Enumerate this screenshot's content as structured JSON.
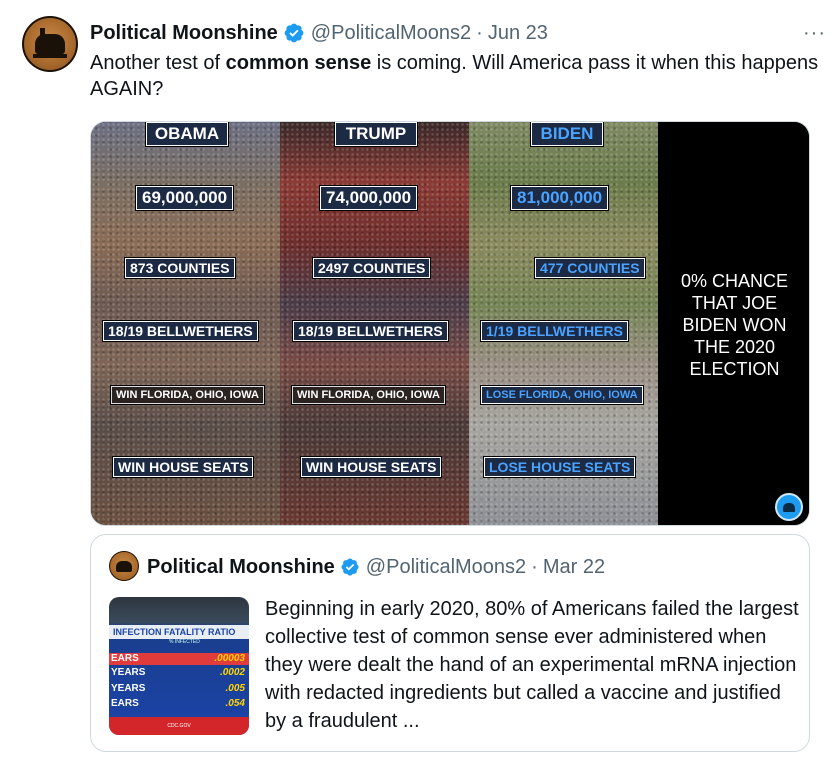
{
  "tweet": {
    "author_name": "Political Moonshine",
    "handle": "@PoliticalMoons2",
    "separator": "·",
    "date": "Jun 23",
    "more": "···",
    "text_before": "Another test of ",
    "text_bold": "common sense",
    "text_after": " is coming. Will America pass it when this happens AGAIN?"
  },
  "media": {
    "columns": [
      {
        "header": "OBAMA",
        "votes": "69,000,000",
        "counties": "873 COUNTIES",
        "bellwethers": "18/19 BELLWETHERS",
        "states": "WIN FLORIDA, OHIO, IOWA",
        "house": "WIN HOUSE SEATS"
      },
      {
        "header": "TRUMP",
        "votes": "74,000,000",
        "counties": "2497 COUNTIES",
        "bellwethers": "18/19 BELLWETHERS",
        "states": "WIN FLORIDA, OHIO, IOWA",
        "house": "WIN HOUSE SEATS"
      },
      {
        "header": "BIDEN",
        "votes": "81,000,000",
        "counties": "477 COUNTIES",
        "bellwethers": "1/19 BELLWETHERS",
        "states": "LOSE FLORIDA, OHIO, IOWA",
        "house": "LOSE HOUSE SEATS"
      }
    ],
    "side_text": "0% CHANCE THAT JOE BIDEN WON THE 2020 ELECTION"
  },
  "quote": {
    "author_name": "Political Moonshine",
    "handle": "@PoliticalMoons2",
    "separator": "·",
    "date": "Mar 22",
    "text": "Beginning in early 2020, 80% of Americans failed the largest collective test of common sense ever administered when they were dealt the hand of an experimental mRNA injection with redacted ingredients but called a vaccine and justified by a fraudulent ...",
    "thumb": {
      "title": "INFECTION FATALITY RATIO",
      "subtitle": "% INFECTED",
      "rows": [
        {
          "left": "EARS",
          "right": ".00003"
        },
        {
          "left": "YEARS",
          "right": ".0002"
        },
        {
          "left": "YEARS",
          "right": ".005"
        },
        {
          "left": "EARS",
          "right": ".054"
        }
      ],
      "footer": "CDC.GOV"
    }
  },
  "colors": {
    "verified": "#1d9bf0",
    "secondary_text": "#536471",
    "biden_label": "#4aa3ff"
  }
}
